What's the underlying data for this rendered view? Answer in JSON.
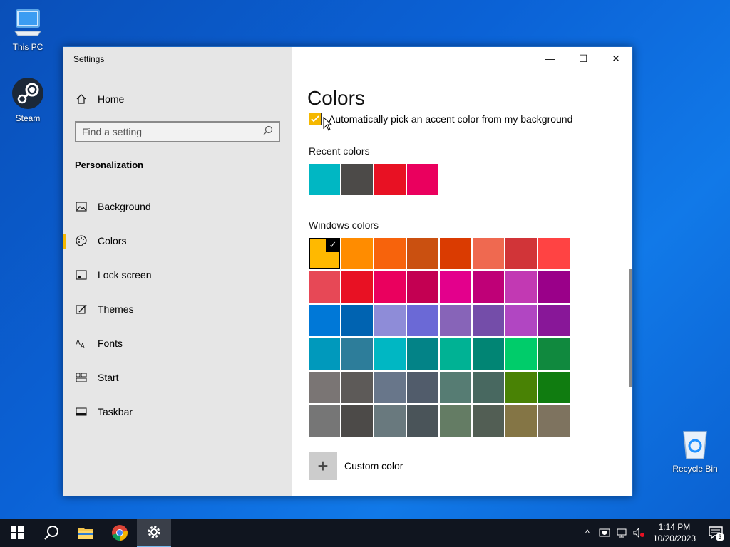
{
  "desktop": {
    "icons": [
      {
        "label": "This PC"
      },
      {
        "label": "Steam"
      },
      {
        "label": "Recycle Bin"
      }
    ]
  },
  "window": {
    "title": "Settings",
    "controls": {
      "minimize": "—",
      "maximize": "☐",
      "close": "✕"
    }
  },
  "sidebar": {
    "home_label": "Home",
    "search_placeholder": "Find a setting",
    "section_title": "Personalization",
    "items": [
      {
        "label": "Background",
        "icon": "image-icon"
      },
      {
        "label": "Colors",
        "icon": "palette-icon",
        "selected": true
      },
      {
        "label": "Lock screen",
        "icon": "lock-screen-icon"
      },
      {
        "label": "Themes",
        "icon": "themes-icon"
      },
      {
        "label": "Fonts",
        "icon": "fonts-icon"
      },
      {
        "label": "Start",
        "icon": "start-icon"
      },
      {
        "label": "Taskbar",
        "icon": "taskbar-icon"
      }
    ]
  },
  "content": {
    "page_title": "Colors",
    "auto_accent_label": "Automatically pick an accent color from my background",
    "auto_accent_checked": true,
    "recent_colors_label": "Recent colors",
    "recent_colors": [
      "#00b7c3",
      "#4c4a48",
      "#e81123",
      "#ea005e"
    ],
    "windows_colors_label": "Windows colors",
    "windows_colors": [
      "#ffb900",
      "#ff8c00",
      "#f7630c",
      "#ca5010",
      "#da3b01",
      "#ef6950",
      "#d13438",
      "#ff4343",
      "#e74856",
      "#e81123",
      "#ea005e",
      "#c30052",
      "#e3008c",
      "#bf0077",
      "#c239b3",
      "#9a0089",
      "#0078d7",
      "#0063b1",
      "#8e8cd8",
      "#6b69d6",
      "#8764b8",
      "#744da9",
      "#b146c2",
      "#881798",
      "#0099bc",
      "#2d7d9a",
      "#00b7c3",
      "#038387",
      "#00b294",
      "#018574",
      "#00cc6a",
      "#10893e",
      "#7a7574",
      "#5d5a58",
      "#68768a",
      "#515c6b",
      "#567c73",
      "#486860",
      "#498205",
      "#107c10",
      "#767676",
      "#4c4a48",
      "#69797e",
      "#4a5459",
      "#647c64",
      "#525e54",
      "#847545",
      "#7e735f"
    ],
    "selected_color_index": 0,
    "check_glyph": "✓",
    "custom_color_label": "Custom color",
    "custom_color_glyph": "+"
  },
  "taskbar": {
    "clock_time": "1:14 PM",
    "clock_date": "10/20/2023",
    "tray_up_glyph": "^",
    "notification_count": "3"
  }
}
